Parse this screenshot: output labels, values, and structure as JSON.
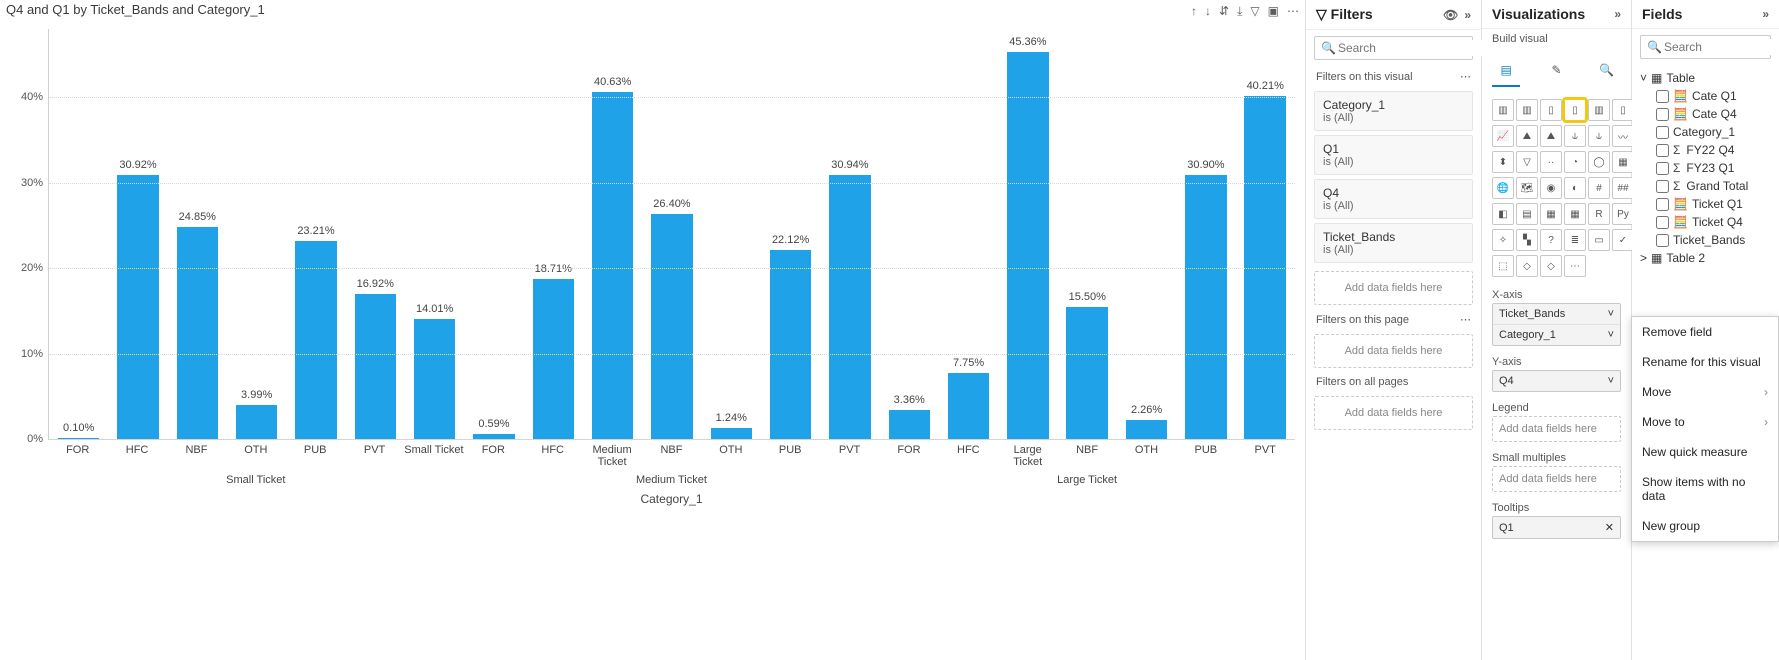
{
  "chart": {
    "title": "Q4 and Q1 by Ticket_Bands and Category_1",
    "ylabel": "Q4",
    "xlabel": "Category_1",
    "toolbar_icons": [
      "arrow-up",
      "arrow-down",
      "drill-expand",
      "drill-next",
      "filter",
      "focus",
      "more"
    ],
    "yticks": [
      "0%",
      "10%",
      "20%",
      "30%",
      "40%"
    ]
  },
  "chart_data": {
    "type": "bar",
    "title": "Q4 and Q1 by Ticket_Bands and Category_1",
    "ylabel": "Q4",
    "xlabel": "Category_1",
    "ylim": [
      0,
      48
    ],
    "groups": [
      {
        "name": "Small Ticket",
        "span": 7
      },
      {
        "name": "Medium Ticket",
        "span": 7
      },
      {
        "name": "Large Ticket",
        "span": 7
      }
    ],
    "categories": [
      "FOR",
      "HFC",
      "NBF",
      "OTH",
      "PUB",
      "PVT",
      "Small Ticket",
      "FOR",
      "HFC",
      "Medium Ticket",
      "NBF",
      "OTH",
      "PUB",
      "PVT",
      "FOR",
      "HFC",
      "Large Ticket",
      "NBF",
      "OTH",
      "PUB",
      "PVT"
    ],
    "values": [
      0.1,
      30.92,
      24.85,
      3.99,
      23.21,
      16.92,
      14.01,
      0.59,
      18.71,
      40.63,
      26.4,
      1.24,
      22.12,
      30.94,
      3.36,
      7.75,
      45.36,
      15.5,
      2.26,
      30.9,
      40.21
    ],
    "labels": [
      "0.10%",
      "30.92%",
      "24.85%",
      "3.99%",
      "23.21%",
      "16.92%",
      "14.01%",
      "0.59%",
      "18.71%",
      "40.63%",
      "26.40%",
      "1.24%",
      "22.12%",
      "30.94%",
      "3.36%",
      "7.75%",
      "45.36%",
      "15.50%",
      "2.26%",
      "30.90%",
      "40.21%"
    ]
  },
  "filters": {
    "pane_title": "Filters",
    "search_placeholder": "Search",
    "section_visual": "Filters on this visual",
    "section_page": "Filters on this page",
    "section_all": "Filters on all pages",
    "cards": [
      {
        "name": "Category_1",
        "value": "is (All)"
      },
      {
        "name": "Q1",
        "value": "is (All)"
      },
      {
        "name": "Q4",
        "value": "is (All)"
      },
      {
        "name": "Ticket_Bands",
        "value": "is (All)"
      }
    ],
    "drop_text": "Add data fields here"
  },
  "viz": {
    "pane_title": "Visualizations",
    "sub": "Build visual",
    "items": [
      "stacked-bar",
      "clustered-bar",
      "stacked-column",
      "clustered-column",
      "stacked-bar-100",
      "clustered-column-100",
      "line",
      "area",
      "stacked-area",
      "line-stacked-column",
      "line-clustered-column",
      "ribbon",
      "waterfall",
      "funnel",
      "scatter",
      "pie",
      "donut",
      "treemap",
      "map",
      "filled-map",
      "azure-map",
      "gauge",
      "card",
      "multi-card",
      "kpi",
      "slicer",
      "table",
      "matrix",
      "r",
      "py",
      "key-influencers",
      "decomposition",
      "qna",
      "narrative",
      "paginated",
      "scorecard",
      "metrics",
      "arcgis",
      "pbiviz",
      "more"
    ],
    "selected_index": 3,
    "xaxis_label": "X-axis",
    "xaxis_items": [
      "Ticket_Bands",
      "Category_1"
    ],
    "yaxis_label": "Y-axis",
    "yaxis_items": [
      "Q4"
    ],
    "legend_label": "Legend",
    "small_multiples_label": "Small multiples",
    "tooltips_label": "Tooltips",
    "tooltips_items": [
      "Q1"
    ],
    "empty_well": "Add data fields here"
  },
  "fields": {
    "pane_title": "Fields",
    "search_placeholder": "Search",
    "tables": [
      {
        "name": "Table",
        "expanded": true,
        "fields": [
          {
            "name": "Cate Q1",
            "sigma": false,
            "measure": true
          },
          {
            "name": "Cate Q4",
            "sigma": false,
            "measure": true
          },
          {
            "name": "Category_1",
            "sigma": false,
            "measure": false
          },
          {
            "name": "FY22 Q4",
            "sigma": true,
            "measure": false
          },
          {
            "name": "FY23 Q1",
            "sigma": true,
            "measure": false
          },
          {
            "name": "Grand Total",
            "sigma": true,
            "measure": false
          },
          {
            "name": "Ticket Q1",
            "sigma": false,
            "measure": true
          },
          {
            "name": "Ticket Q4",
            "sigma": false,
            "measure": true
          },
          {
            "name": "Ticket_Bands",
            "sigma": false,
            "measure": false
          }
        ]
      },
      {
        "name": "Table 2",
        "expanded": false,
        "fields": []
      }
    ]
  },
  "context_menu": {
    "items": [
      {
        "label": "Remove field",
        "arrow": false
      },
      {
        "label": "Rename for this visual",
        "arrow": false
      },
      {
        "label": "Move",
        "arrow": true
      },
      {
        "label": "Move to",
        "arrow": true
      },
      {
        "label": "New quick measure",
        "arrow": false
      },
      {
        "label": "Show items with no data",
        "arrow": false
      },
      {
        "label": "New group",
        "arrow": false
      }
    ]
  }
}
